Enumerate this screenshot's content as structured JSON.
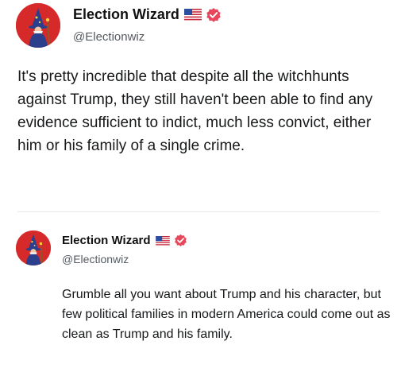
{
  "posts": [
    {
      "author": {
        "display_name": "Election Wizard",
        "handle": "@Electionwiz",
        "flag_icon": "us-flag-icon",
        "verified_icon": "verified-badge-icon",
        "verified_color": "#e8465a",
        "avatar_bg": "#d62a2a"
      },
      "text": "It's pretty incredible that despite all the witchhunts against Trump, they still haven't been able to find any evidence sufficient to indict, much less convict, either him or his family of a single crime."
    },
    {
      "author": {
        "display_name": "Election Wizard",
        "handle": "@Electionwiz",
        "flag_icon": "us-flag-icon",
        "verified_icon": "verified-badge-icon",
        "verified_color": "#e8465a",
        "avatar_bg": "#d62a2a"
      },
      "text": "Grumble all you want about Trump and his character, but few political families in modern America could come out as clean as Trump and his family."
    }
  ]
}
